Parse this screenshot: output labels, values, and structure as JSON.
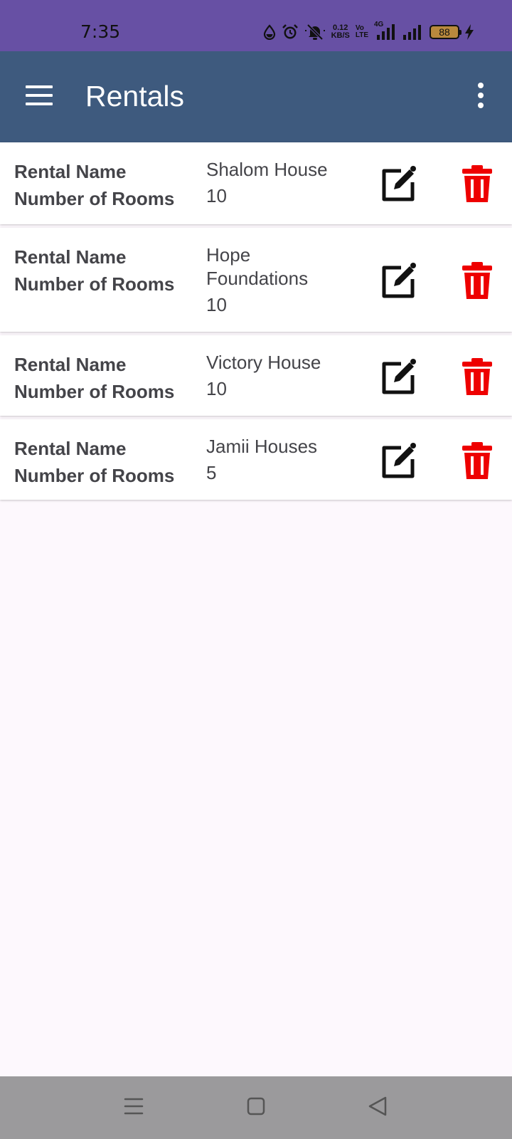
{
  "status_bar": {
    "time": "7:35",
    "net_speed_value": "0.12",
    "net_speed_unit": "KB/S",
    "volte_top": "Vo",
    "volte_bottom": "LTE",
    "network_type": "4G",
    "battery_level": "88",
    "icons": [
      "water-drop-icon",
      "alarm-icon",
      "bell-off-icon",
      "signal-4g-icon",
      "signal-icon",
      "battery-icon",
      "charging-icon"
    ]
  },
  "app_bar": {
    "title": "Rentals",
    "color": "#3e5a7e",
    "menu_icon": "hamburger-menu-icon",
    "overflow_icon": "more-vertical-icon"
  },
  "labels": {
    "rental_name": "Rental Name",
    "rooms": "Number of Rooms"
  },
  "rentals": [
    {
      "name": "Shalom House",
      "rooms": "10"
    },
    {
      "name": "Hope Foundations",
      "rooms": "10"
    },
    {
      "name": "Victory House",
      "rooms": "10"
    },
    {
      "name": "Jamii Houses",
      "rooms": "5"
    }
  ],
  "colors": {
    "status_bar": "#6750a4",
    "delete": "#ee0000",
    "background": "#fdf8fd",
    "nav_bar": "#9b9a9c"
  },
  "nav_bar": {
    "icons": [
      "recent-apps-icon",
      "home-icon",
      "back-icon"
    ]
  }
}
